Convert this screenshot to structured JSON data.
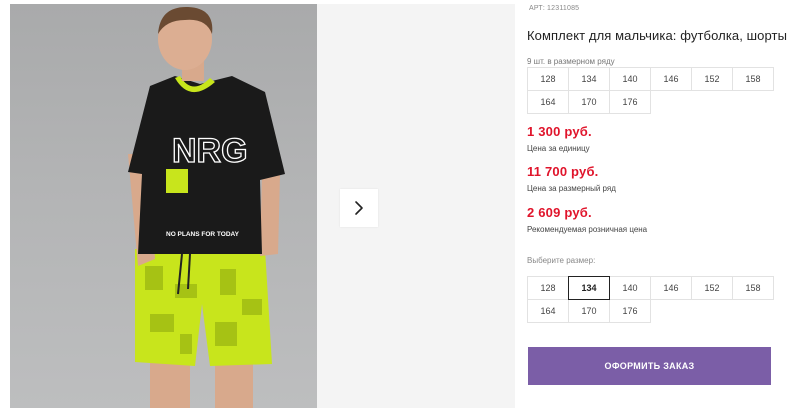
{
  "product": {
    "article_label": "АРТ:",
    "article_number": "12311085",
    "title": "Комплект для мальчика: футболка, шорты"
  },
  "set_sizes": {
    "caption": "9 шт. в размерном ряду",
    "sizes": [
      "128",
      "134",
      "140",
      "146",
      "152",
      "158",
      "164",
      "170",
      "176"
    ]
  },
  "prices": [
    {
      "amount": "1 300 руб.",
      "label": "Цена за единицу"
    },
    {
      "amount": "11 700 руб.",
      "label": "Цена за размерный ряд"
    },
    {
      "amount": "2 609 руб.",
      "label": "Рекомендуемая розничная цена"
    }
  ],
  "size_picker": {
    "caption": "Выберите размер:",
    "sizes": [
      "128",
      "134",
      "140",
      "146",
      "152",
      "158",
      "164",
      "170",
      "176"
    ],
    "selected": "134"
  },
  "order_button_label": "Оформить заказ",
  "gallery": {
    "next_icon": "chevron-right-icon",
    "tshirt_print_top": "NRG",
    "tshirt_print_bottom": "NO PLANS FOR TODAY"
  },
  "colors": {
    "price": "#e0142b",
    "accent_button": "#7b5ea7",
    "lime": "#c8e51c"
  }
}
